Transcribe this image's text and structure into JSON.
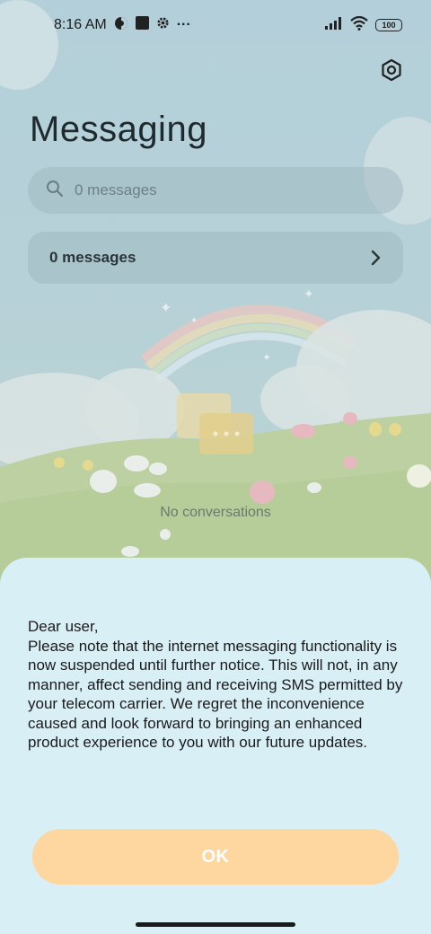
{
  "status_bar": {
    "time": "8:16 AM",
    "more_dots": "···",
    "battery": "100"
  },
  "header": {
    "title": "Messaging"
  },
  "search": {
    "placeholder": "0 messages"
  },
  "messages_card": {
    "label": "0 messages"
  },
  "empty_state": {
    "text": "No conversations"
  },
  "dialog": {
    "message": "Dear user,\nPlease note that the internet messaging functionality is now suspended until further notice. This will not, in any manner, affect sending and receiving SMS permitted by your telecom carrier. We regret the inconvenience caused and look forward to bringing an enhanced product experience to you with our future updates.",
    "ok_label": "OK"
  },
  "icons": [
    "vpn-status-icon",
    "square-notification-icon",
    "settings-gear-status-icon",
    "signal-icon",
    "wifi-icon",
    "battery-icon",
    "settings-icon",
    "search-icon",
    "chevron-right-icon"
  ],
  "colors": {
    "sheet_background": "#d8eff6",
    "ok_button": "#fdd6a0",
    "card_background": "#a0bac2"
  }
}
